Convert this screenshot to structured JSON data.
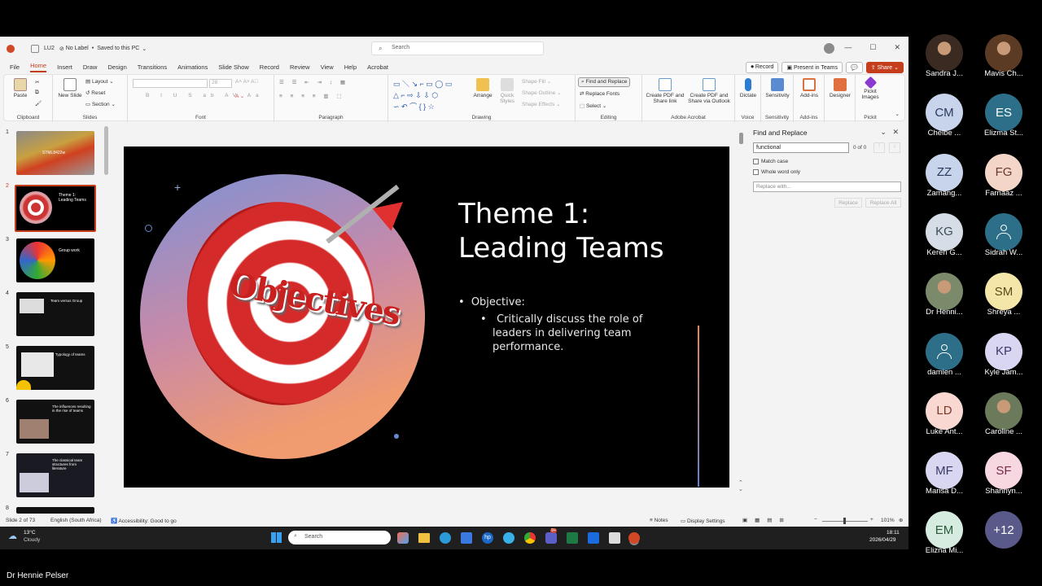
{
  "window": {
    "file": "LU2",
    "label": "No Label",
    "saved": "Saved to this PC",
    "search_placeholder": "Search"
  },
  "menu": [
    "File",
    "Home",
    "Insert",
    "Draw",
    "Design",
    "Transitions",
    "Animations",
    "Slide Show",
    "Record",
    "Review",
    "View",
    "Help",
    "Acrobat"
  ],
  "top_buttons": {
    "record": "Record",
    "present": "Present in Teams",
    "share": "Share"
  },
  "ribbon": {
    "clipboard": {
      "paste": "Paste",
      "label": "Clipboard"
    },
    "slides": {
      "new_slide": "New Slide",
      "layout": "Layout",
      "reset": "Reset",
      "section": "Section",
      "label": "Slides"
    },
    "font": {
      "size": "28",
      "label": "Font"
    },
    "paragraph": {
      "label": "Paragraph"
    },
    "drawing": {
      "arrange": "Arrange",
      "quick_styles": "Quick Styles",
      "fill": "Shape Fill",
      "outline": "Shape Outline",
      "effects": "Shape Effects",
      "label": "Drawing"
    },
    "editing": {
      "find_replace": "Find and Replace",
      "replace_fonts": "Replace Fonts",
      "select": "Select",
      "label": "Editing"
    },
    "acrobat": {
      "pdf_share": "Create PDF and Share link",
      "pdf_outlook": "Create PDF and Share via Outlook",
      "label": "Adobe Acrobat"
    },
    "voice": {
      "dictate": "Dictate",
      "label": "Voice"
    },
    "sensitivity": {
      "btn": "Sensitivity",
      "label": "Sensitivity"
    },
    "addins": {
      "btn": "Add-ins",
      "label": "Add-ins"
    },
    "designer": {
      "btn": "Designer"
    },
    "pickit": {
      "btn": "Pickit Images",
      "label": "Pickit"
    }
  },
  "thumbnails": [
    {
      "num": "1",
      "title": "STML8422w"
    },
    {
      "num": "2",
      "title": "Theme 1: Leading Teams"
    },
    {
      "num": "3",
      "title": "Group work"
    },
    {
      "num": "4",
      "title": "Team versus Group"
    },
    {
      "num": "5",
      "title": "Typology of teams"
    },
    {
      "num": "6",
      "title": "The influences resulting in the rise of teams"
    },
    {
      "num": "7",
      "title": "The classical team structures from literature"
    },
    {
      "num": "8",
      "title": ""
    }
  ],
  "slide": {
    "title_line1": "Theme 1:",
    "title_line2": "Leading Teams",
    "bullet1": "Objective:",
    "bullet2": "Critically discuss the role of leaders in delivering team performance.",
    "image_text": "Objectives"
  },
  "find_replace": {
    "title": "Find and Replace",
    "search_value": "functional",
    "count": "0 of 0",
    "match_case": "Match case",
    "whole_word": "Whole word only",
    "replace_placeholder": "Replace with...",
    "replace": "Replace",
    "replace_all": "Replace All"
  },
  "status": {
    "slide": "Slide 2 of 73",
    "language": "English (South Africa)",
    "accessibility": "Accessibility: Good to go",
    "notes": "Notes",
    "display": "Display Settings",
    "zoom": "101%"
  },
  "taskbar": {
    "weather_temp": "13°C",
    "weather_desc": "Cloudy",
    "search": "Search",
    "time": "18:11",
    "date": "2026/04/29",
    "teams_badge": "9+"
  },
  "participants": [
    {
      "initials": "",
      "name": "Sandra J...",
      "photo": true,
      "color": "#3a2a22"
    },
    {
      "initials": "",
      "name": "Mavis Ch...",
      "photo": true,
      "color": "#5b3b24"
    },
    {
      "initials": "CM",
      "name": "Chélbe ...",
      "color": "#c8d4ec",
      "text": "#2a3a5a"
    },
    {
      "initials": "ES",
      "name": "Elizma St...",
      "color": "#2d6f89",
      "text": "#ffffff"
    },
    {
      "initials": "ZZ",
      "name": "Zamang...",
      "color": "#c8d4ec",
      "text": "#2a3a5a"
    },
    {
      "initials": "FG",
      "name": "Farnaaz ...",
      "color": "#f4d6c8",
      "text": "#6a3a2a"
    },
    {
      "initials": "KG",
      "name": "Keren G...",
      "color": "#d6dde6",
      "text": "#3a4a5a"
    },
    {
      "initials": "",
      "name": "Sidrah W...",
      "person_icon": true,
      "color": "#2d6f89"
    },
    {
      "initials": "",
      "name": "Dr Henni...",
      "photo": true,
      "color": "#7a8a6a"
    },
    {
      "initials": "SM",
      "name": "Shreya ...",
      "color": "#f4e6a8",
      "text": "#5a4a1a"
    },
    {
      "initials": "",
      "name": "damien ...",
      "person_icon": true,
      "color": "#2d6f89"
    },
    {
      "initials": "KP",
      "name": "Kyle Jam...",
      "color": "#d8d6f0",
      "text": "#3a3a6a"
    },
    {
      "initials": "LD",
      "name": "Luke Ant...",
      "color": "#f8d8d0",
      "text": "#7a3a2a"
    },
    {
      "initials": "",
      "name": "Caroline ...",
      "photo": true,
      "color": "#6a7a5a"
    },
    {
      "initials": "MF",
      "name": "Marisa D...",
      "color": "#d8d6f0",
      "text": "#3a3a6a"
    },
    {
      "initials": "SF",
      "name": "Shannyn...",
      "color": "#f8d8e0",
      "text": "#7a2a4a"
    },
    {
      "initials": "EM",
      "name": "Elizna Mi...",
      "color": "#d6ece0",
      "text": "#2a5a3a"
    },
    {
      "initials": "+12",
      "name": "",
      "color": "#5a5a8a",
      "text": "#ffffff"
    }
  ],
  "presenter": "Dr Hennie Pelser"
}
